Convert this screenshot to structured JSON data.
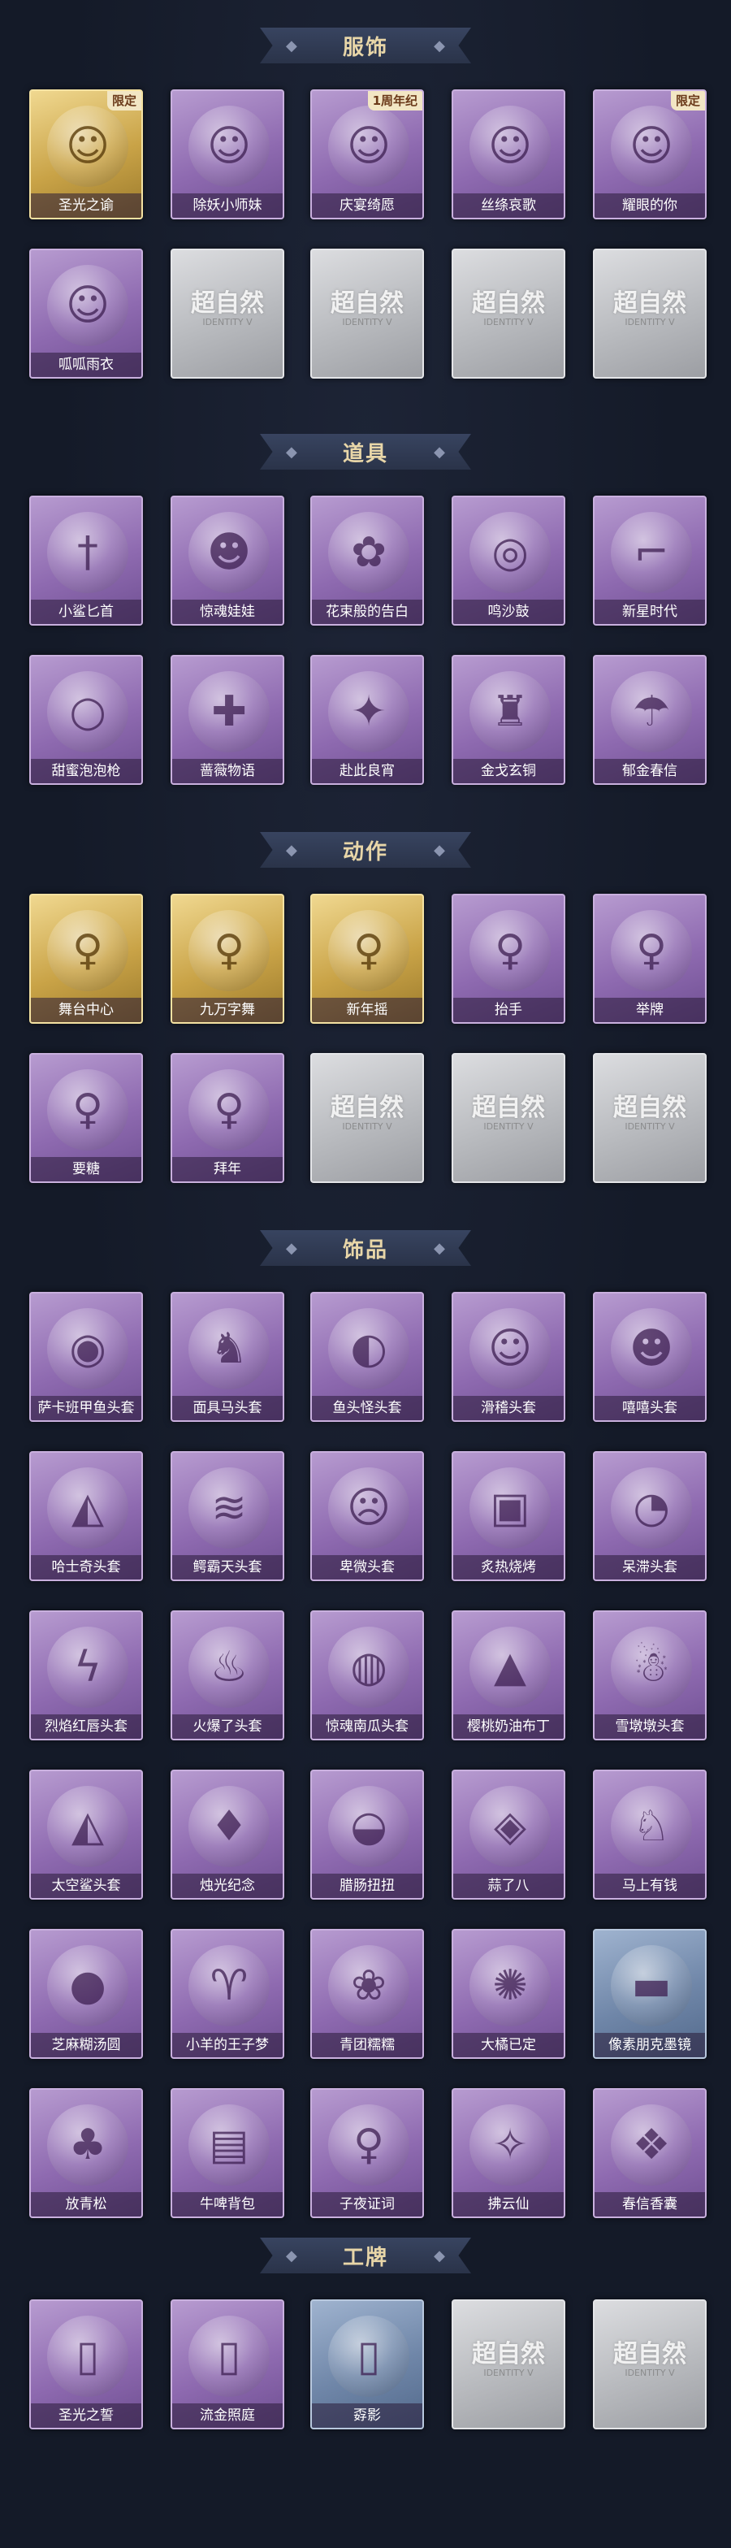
{
  "watermark": {
    "text": "超自然",
    "sub": "IDENTITY V"
  },
  "sections": [
    {
      "title": "服饰",
      "items": [
        {
          "label": "圣光之谕",
          "variant": "gold",
          "badge": "限定",
          "icon": "portrait-icon"
        },
        {
          "label": "除妖小师妹",
          "variant": "purple",
          "badge": "",
          "icon": "portrait-icon"
        },
        {
          "label": "庆宴绮愿",
          "variant": "purple",
          "badge": "1周年纪",
          "icon": "portrait-icon"
        },
        {
          "label": "丝绦哀歌",
          "variant": "purple",
          "badge": "",
          "icon": "portrait-icon"
        },
        {
          "label": "耀眼的你",
          "variant": "purple",
          "badge": "限定",
          "icon": "portrait-icon"
        },
        {
          "label": "呱呱雨衣",
          "variant": "purple",
          "badge": "",
          "icon": "portrait-icon"
        },
        {
          "label": "",
          "variant": "placeholder",
          "badge": "",
          "icon": ""
        },
        {
          "label": "",
          "variant": "placeholder",
          "badge": "",
          "icon": ""
        },
        {
          "label": "",
          "variant": "placeholder",
          "badge": "",
          "icon": ""
        },
        {
          "label": "",
          "variant": "placeholder",
          "badge": "",
          "icon": ""
        }
      ]
    },
    {
      "title": "道具",
      "items": [
        {
          "label": "小鲨匕首",
          "variant": "purple",
          "badge": "",
          "icon": "dagger-icon"
        },
        {
          "label": "惊魂娃娃",
          "variant": "purple",
          "badge": "",
          "icon": "doll-icon"
        },
        {
          "label": "花束般的告白",
          "variant": "purple",
          "badge": "",
          "icon": "rose-icon"
        },
        {
          "label": "鸣沙鼓",
          "variant": "purple",
          "badge": "",
          "icon": "drum-icon"
        },
        {
          "label": "新星时代",
          "variant": "purple",
          "badge": "",
          "icon": "gun-icon"
        },
        {
          "label": "甜蜜泡泡枪",
          "variant": "purple",
          "badge": "",
          "icon": "bubble-gun-icon"
        },
        {
          "label": "蔷薇物语",
          "variant": "purple",
          "badge": "",
          "icon": "box-icon"
        },
        {
          "label": "赴此良宵",
          "variant": "purple",
          "badge": "",
          "icon": "lantern-icon"
        },
        {
          "label": "金戈玄铜",
          "variant": "purple",
          "badge": "",
          "icon": "lamp-icon"
        },
        {
          "label": "郁金春信",
          "variant": "purple",
          "badge": "",
          "icon": "umbrella-icon"
        }
      ]
    },
    {
      "title": "动作",
      "items": [
        {
          "label": "舞台中心",
          "variant": "gold",
          "badge": "",
          "icon": "figure-icon"
        },
        {
          "label": "九万字舞",
          "variant": "gold",
          "badge": "",
          "icon": "figure-icon"
        },
        {
          "label": "新年摇",
          "variant": "gold",
          "badge": "",
          "icon": "figure-icon"
        },
        {
          "label": "抬手",
          "variant": "purple",
          "badge": "",
          "icon": "figure-icon"
        },
        {
          "label": "举牌",
          "variant": "purple",
          "badge": "",
          "icon": "figure-icon"
        },
        {
          "label": "要糖",
          "variant": "purple",
          "badge": "",
          "icon": "figure-icon"
        },
        {
          "label": "拜年",
          "variant": "purple",
          "badge": "",
          "icon": "figure-icon"
        },
        {
          "label": "",
          "variant": "placeholder",
          "badge": "",
          "icon": ""
        },
        {
          "label": "",
          "variant": "placeholder",
          "badge": "",
          "icon": ""
        },
        {
          "label": "",
          "variant": "placeholder",
          "badge": "",
          "icon": ""
        }
      ]
    },
    {
      "title": "饰品",
      "items": [
        {
          "label": "萨卡班甲鱼头套",
          "variant": "purple",
          "badge": "",
          "icon": "fish-head-icon"
        },
        {
          "label": "面具马头套",
          "variant": "purple",
          "badge": "",
          "icon": "horse-head-icon"
        },
        {
          "label": "鱼头怪头套",
          "variant": "purple",
          "badge": "",
          "icon": "fish-monster-icon"
        },
        {
          "label": "滑稽头套",
          "variant": "purple",
          "badge": "",
          "icon": "smiley-icon"
        },
        {
          "label": "嘻嘻头套",
          "variant": "purple",
          "badge": "",
          "icon": "grin-icon"
        },
        {
          "label": "哈士奇头套",
          "variant": "purple",
          "badge": "",
          "icon": "dog-icon"
        },
        {
          "label": "鳄霸天头套",
          "variant": "purple",
          "badge": "",
          "icon": "crocodile-icon"
        },
        {
          "label": "卑微头套",
          "variant": "purple",
          "badge": "",
          "icon": "sad-face-icon"
        },
        {
          "label": "炙热烧烤",
          "variant": "purple",
          "badge": "",
          "icon": "toast-icon"
        },
        {
          "label": "呆滞头套",
          "variant": "purple",
          "badge": "",
          "icon": "dazed-face-icon"
        },
        {
          "label": "烈焰红唇头套",
          "variant": "purple",
          "badge": "",
          "icon": "pikachu-icon"
        },
        {
          "label": "火爆了头套",
          "variant": "purple",
          "badge": "",
          "icon": "fire-icon"
        },
        {
          "label": "惊魂南瓜头套",
          "variant": "purple",
          "badge": "",
          "icon": "pumpkin-icon"
        },
        {
          "label": "樱桃奶油布丁",
          "variant": "purple",
          "badge": "",
          "icon": "pudding-icon"
        },
        {
          "label": "雪墩墩头套",
          "variant": "purple",
          "badge": "",
          "icon": "snowman-icon"
        },
        {
          "label": "太空鲨头套",
          "variant": "purple",
          "badge": "",
          "icon": "shark-icon"
        },
        {
          "label": "烛光纪念",
          "variant": "purple",
          "badge": "",
          "icon": "candle-icon"
        },
        {
          "label": "腊肠扭扭",
          "variant": "purple",
          "badge": "",
          "icon": "dachshund-icon"
        },
        {
          "label": "蒜了八",
          "variant": "purple",
          "badge": "",
          "icon": "garlic-icon"
        },
        {
          "label": "马上有钱",
          "variant": "purple",
          "badge": "",
          "icon": "horse-icon"
        },
        {
          "label": "芝麻糊汤圆",
          "variant": "purple",
          "badge": "",
          "icon": "dumpling-icon"
        },
        {
          "label": "小羊的王子梦",
          "variant": "purple",
          "badge": "",
          "icon": "sheep-icon"
        },
        {
          "label": "青团糯糯",
          "variant": "purple",
          "badge": "",
          "icon": "green-bun-icon"
        },
        {
          "label": "大橘已定",
          "variant": "purple",
          "badge": "",
          "icon": "orange-icon"
        },
        {
          "label": "像素朋克墨镜",
          "variant": "blue",
          "badge": "",
          "icon": "sunglasses-icon"
        },
        {
          "label": "放青松",
          "variant": "purple",
          "badge": "",
          "icon": "pine-icon"
        },
        {
          "label": "牛啤背包",
          "variant": "purple",
          "badge": "",
          "icon": "backpack-icon"
        },
        {
          "label": "子夜证词",
          "variant": "purple",
          "badge": "",
          "icon": "figure-icon"
        },
        {
          "label": "拂云仙",
          "variant": "purple",
          "badge": "",
          "icon": "pendant-icon"
        },
        {
          "label": "春信香囊",
          "variant": "purple",
          "badge": "",
          "icon": "sachet-icon"
        }
      ]
    },
    {
      "title": "工牌",
      "items": [
        {
          "label": "圣光之誓",
          "variant": "purple",
          "badge": "",
          "icon": "card-icon"
        },
        {
          "label": "流金照庭",
          "variant": "purple",
          "badge": "",
          "icon": "card-icon"
        },
        {
          "label": "孬影",
          "variant": "blue",
          "badge": "",
          "icon": "card-icon"
        },
        {
          "label": "",
          "variant": "placeholder",
          "badge": "",
          "icon": ""
        },
        {
          "label": "",
          "variant": "placeholder",
          "badge": "",
          "icon": ""
        }
      ]
    }
  ]
}
